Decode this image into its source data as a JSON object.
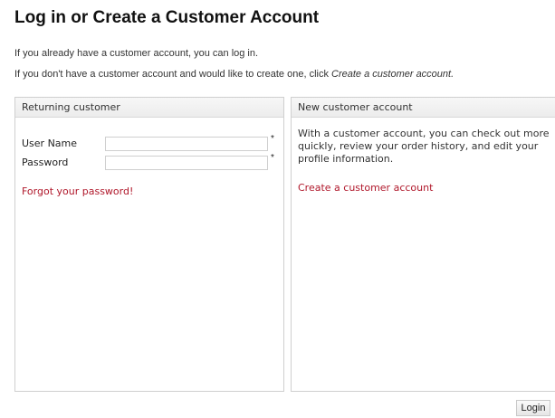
{
  "page": {
    "title": "Log in or Create a Customer Account",
    "intro_line1": "If you already have a customer account, you can log in.",
    "intro_line2_prefix": "If you don't have a customer account and would like to create one, click ",
    "intro_line2_emphasis": "Create a customer account."
  },
  "returning": {
    "header": "Returning customer",
    "username_label": "User Name",
    "username_value": "",
    "username_required": "*",
    "password_label": "Password",
    "password_value": "",
    "password_required": "*",
    "forgot_link": "Forgot your password!"
  },
  "new_account": {
    "header": "New customer account",
    "description": "With a customer account, you can check out more quickly, review your order history, and edit your profile information.",
    "create_link": "Create a customer account"
  },
  "actions": {
    "login_label": "Login"
  },
  "colors": {
    "link": "#b0182b",
    "panel_border": "#cfcfcf"
  }
}
